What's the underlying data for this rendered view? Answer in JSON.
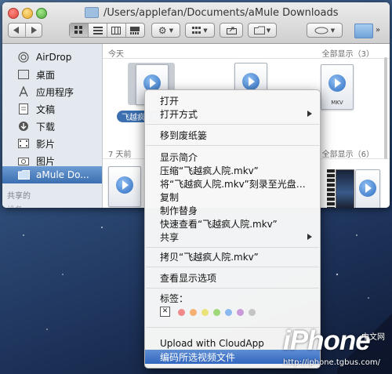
{
  "window": {
    "title": "/Users/applefan/Documents/aMule Downloads"
  },
  "sidebar": {
    "items": [
      {
        "label": "AirDrop"
      },
      {
        "label": "桌面"
      },
      {
        "label": "应用程序"
      },
      {
        "label": "文稿"
      },
      {
        "label": "下载"
      },
      {
        "label": "影片"
      },
      {
        "label": "图片"
      },
      {
        "label": "aMule Do..."
      }
    ],
    "shared_header": "共享的",
    "devices_header": "设备"
  },
  "main": {
    "group_today": {
      "label": "今天",
      "show_all": "全部显示（3）"
    },
    "group_week": {
      "label": "7 天前",
      "show_all": "全部显示（6）"
    },
    "selected_file_label": "飞越疯人院",
    "file_ext": "MKV"
  },
  "context_menu": {
    "items": [
      {
        "label": "打开"
      },
      {
        "label": "打开方式"
      },
      {
        "label": "移到废纸篓"
      },
      {
        "label": "显示简介"
      },
      {
        "label": "压缩“飞越疯人院.mkv”"
      },
      {
        "label": "将“飞越疯人院.mkv”刻录至光盘…"
      },
      {
        "label": "复制"
      },
      {
        "label": "制作替身"
      },
      {
        "label": "快速查看“飞越疯人院.mkv”"
      },
      {
        "label": "共享"
      },
      {
        "label": "拷贝“飞越疯人院.mkv”"
      },
      {
        "label": "查看显示选项"
      },
      {
        "label": "标签："
      },
      {
        "label": "Upload with CloudApp"
      },
      {
        "label": "编码所选视频文件"
      }
    ],
    "tag_colors": [
      "#f08a8a",
      "#f4b070",
      "#ece27a",
      "#9ed879",
      "#8ab8f0",
      "#c99ad8",
      "#c4c4c4"
    ],
    "tag_clear_glyph": "✕"
  },
  "watermark": {
    "brand": "iPhone",
    "site": "中文网",
    "url": "http://iphone.tgbus.com/"
  }
}
